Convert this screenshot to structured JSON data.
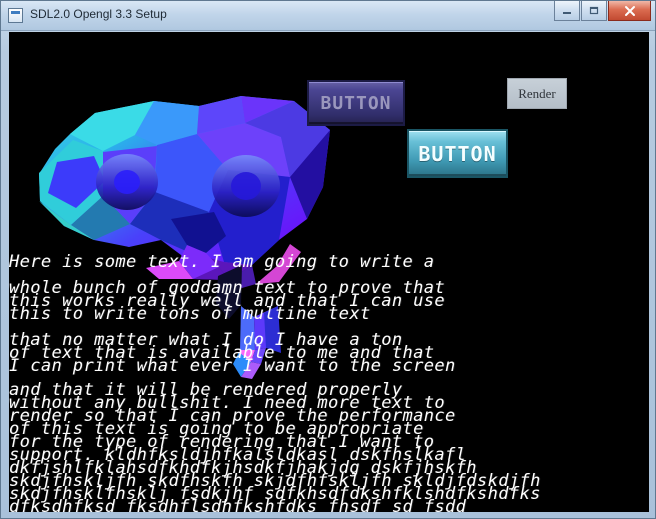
{
  "window": {
    "title": "SDL2.0 Opengl 3.3 Setup"
  },
  "controls": {
    "minimize_icon": "minimize-icon",
    "maximize_icon": "maximize-icon",
    "close_icon": "close-icon"
  },
  "ui": {
    "button_purple": "BUTTON",
    "button_render": "Render",
    "button_cyan": "BUTTON"
  },
  "text": {
    "lines": [
      "Here is some text. I am going to write a",
      "whole bunch of goddamn text to prove that",
      "this works really well and that I can use",
      "this to write tons of multine text",
      "that no matter what I do I have a ton",
      "of text that is available to me and that",
      "I can print what ever I want to the screen",
      "and that it will be rendered properly",
      "without any bullshit. I need more text to",
      "render so that I can prove the performance",
      "of this text is going to be appropriate",
      "for the type of rendering that I want to",
      "support. kldhfksldjhfkalsldkasl dskfhslkafl",
      "dkfjshlfklahsdfkhdfkjhsdkfjhakjdg dskfjhskfh",
      "skdjfhskljfh skdfhskfh skjdfhfskljfh skldjfdskdjfh",
      "skdjfhsklfhsklj fsdkjhf sdfkhsdfdkshfklshdfkshdfks",
      "dfksdhfksd fksdhflsdhfkshfdks fhsdf sd fsdd"
    ]
  },
  "colors": {
    "window_background": "#000000",
    "button_purple": "#4b4693",
    "button_cyan": "#67bfd6",
    "button_render": "#c7d0d8",
    "text": "#ffffff"
  }
}
